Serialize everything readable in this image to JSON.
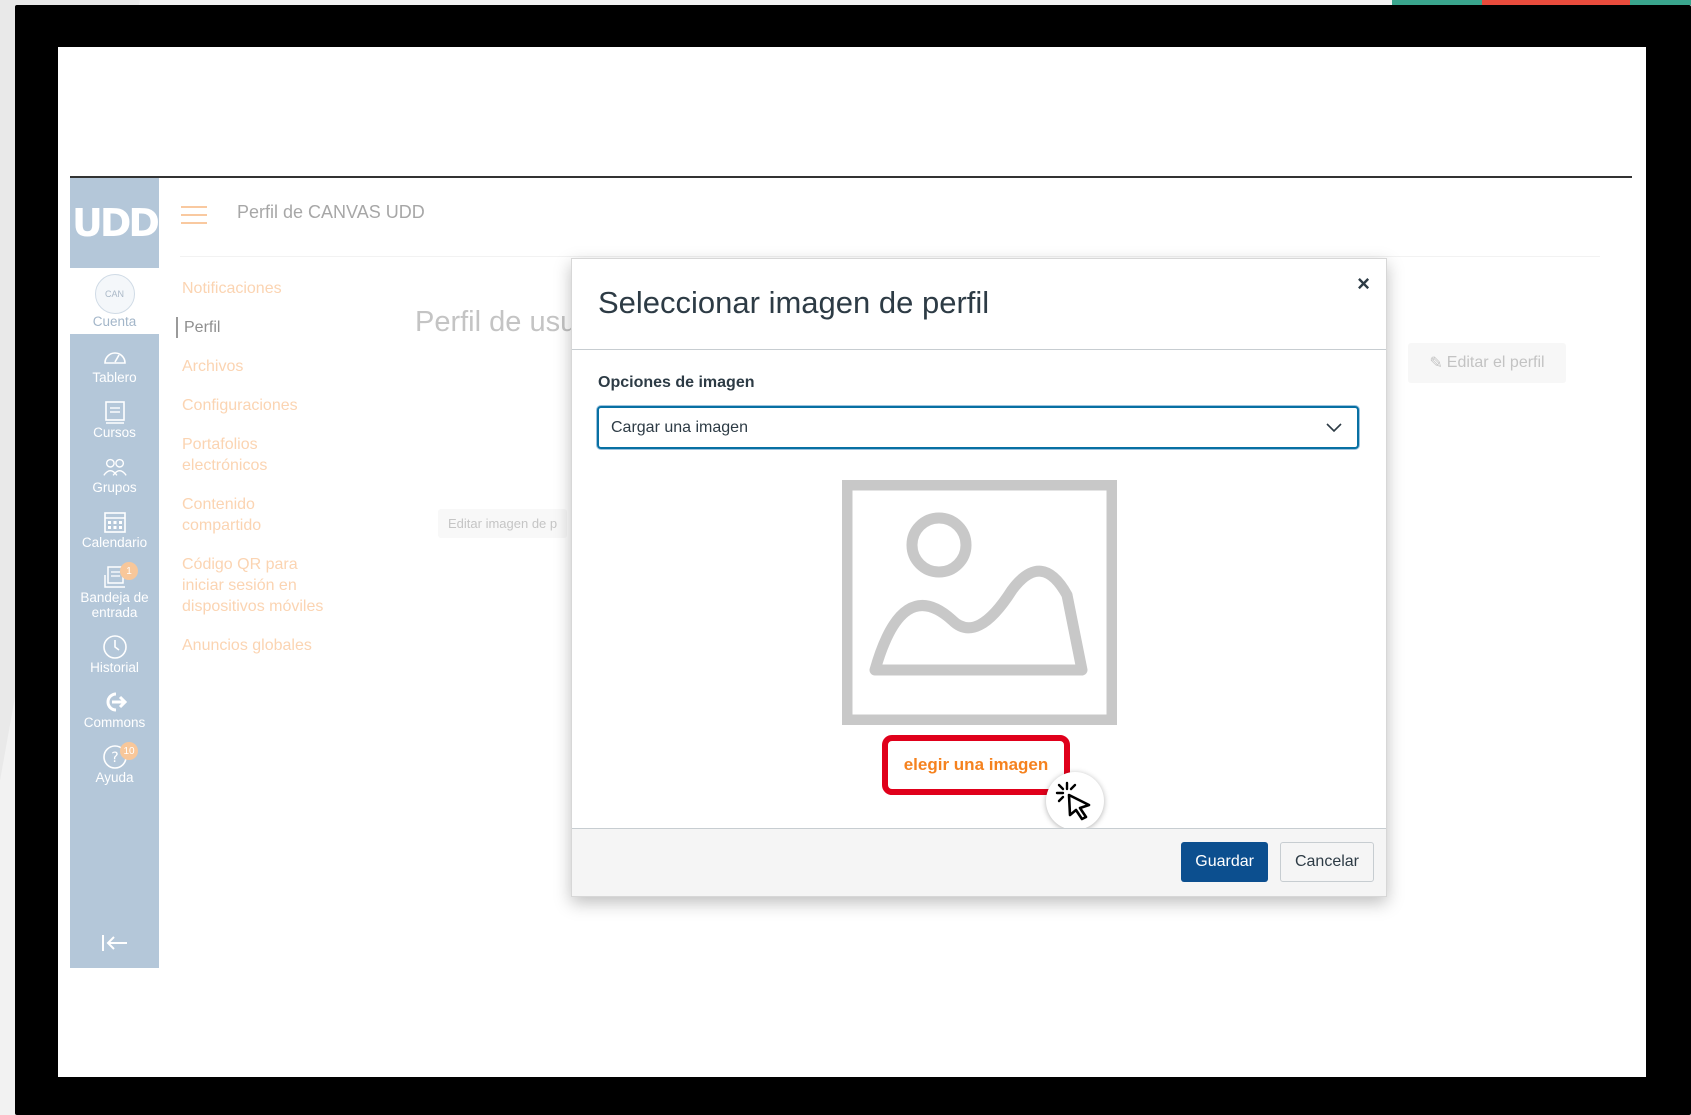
{
  "app": {
    "breadcrumb": "Perfil de CANVAS UDD",
    "page_title": "Perfil de usu",
    "edit_photo_label": "Editar imagen de p",
    "edit_profile_label": "Editar el perfil",
    "logo_text": "UDD"
  },
  "global_nav": [
    {
      "label": "Cuenta",
      "icon": "avatar"
    },
    {
      "label": "Tablero",
      "icon": "dashboard-icon"
    },
    {
      "label": "Cursos",
      "icon": "courses-icon"
    },
    {
      "label": "Grupos",
      "icon": "groups-icon"
    },
    {
      "label": "Calendario",
      "icon": "calendar-icon"
    },
    {
      "label": "Bandeja de entrada",
      "icon": "inbox-icon",
      "badge": "1"
    },
    {
      "label": "Historial",
      "icon": "history-icon"
    },
    {
      "label": "Commons",
      "icon": "commons-icon"
    },
    {
      "label": "Ayuda",
      "icon": "help-icon",
      "badge": "10"
    }
  ],
  "account_avatar_alt": "CAN",
  "side_menu": [
    "Notificaciones",
    "Perfil",
    "Archivos",
    "Configuraciones",
    "Portafolios electrónicos",
    "Contenido compartido",
    "Código QR para iniciar sesión en dispositivos móviles",
    "Anuncios globales"
  ],
  "modal": {
    "title": "Seleccionar imagen de perfil",
    "close": "×",
    "options_label": "Opciones de imagen",
    "select_value": "Cargar una imagen",
    "choose_link": "elegir una imagen",
    "save": "Guardar",
    "cancel": "Cancelar"
  },
  "colors": {
    "nav_bg": "#b4c7d9",
    "accent_orange": "#f5821f",
    "highlight_red": "#e0001b",
    "primary_button": "#0c4f8f"
  }
}
